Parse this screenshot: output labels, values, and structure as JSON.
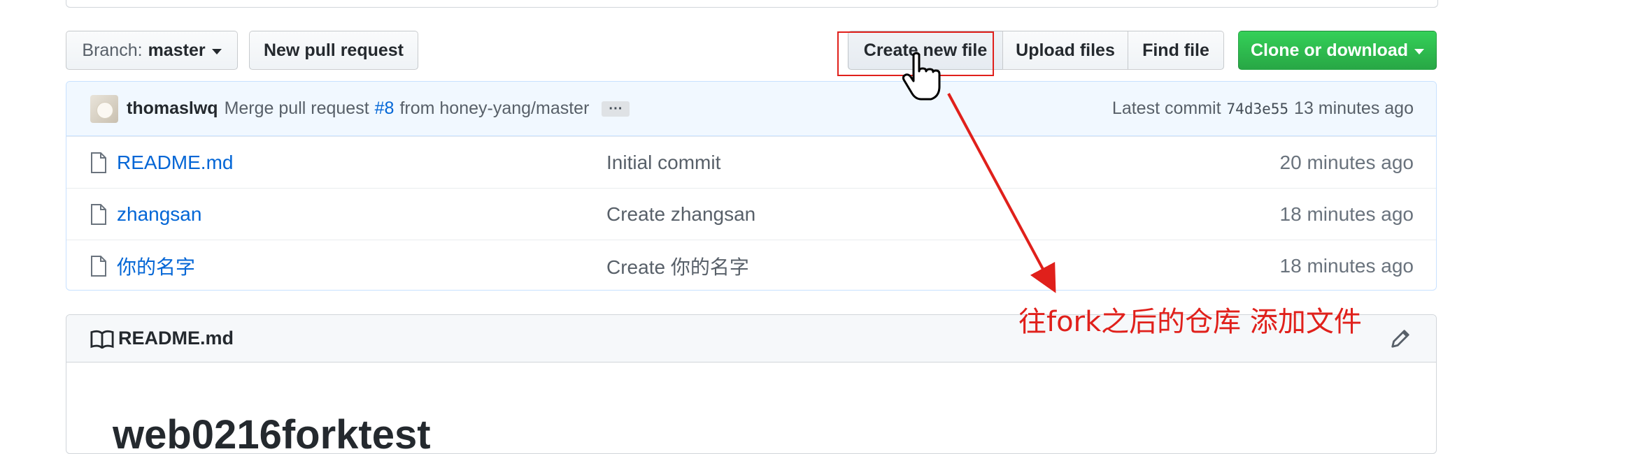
{
  "toolbar": {
    "branch_prefix": "Branch:",
    "branch_name": "master",
    "new_pr_label": "New pull request",
    "create_file_label": "Create new file",
    "upload_label": "Upload files",
    "find_label": "Find file",
    "clone_label": "Clone or download",
    "clone_color": "#28a745"
  },
  "commit": {
    "author": "thomaslwq",
    "message_pre": "Merge pull request",
    "pr_link": "#8",
    "message_post": "from honey-yang/master",
    "ellipsis": "···",
    "latest_label": "Latest commit",
    "sha": "74d3e55",
    "age": "13 minutes ago"
  },
  "files": [
    {
      "name": "README.md",
      "message": "Initial commit",
      "age": "20 minutes ago"
    },
    {
      "name": "zhangsan",
      "message": "Create zhangsan",
      "age": "18 minutes ago"
    },
    {
      "name": "你的名字",
      "message": "Create 你的名字",
      "age": "18 minutes ago"
    }
  ],
  "readme": {
    "header": "README.md",
    "title": "web0216forktest"
  },
  "annotation": {
    "text": "往fork之后的仓库 添加文件",
    "color": "#e0201b"
  },
  "icons": [
    "caret-down-icon",
    "file-icon",
    "book-icon",
    "pencil-icon",
    "hand-cursor-icon"
  ]
}
